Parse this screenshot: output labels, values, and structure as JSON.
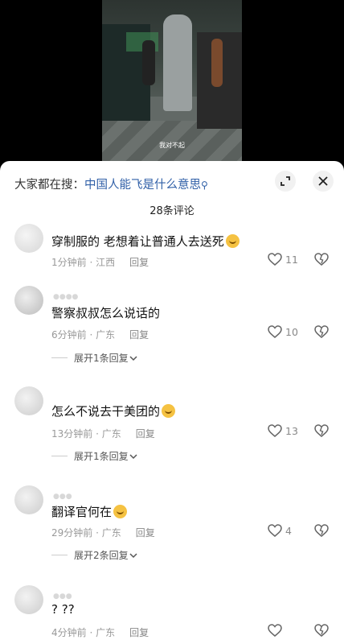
{
  "video": {
    "subtitle": "我对不起"
  },
  "panel": {
    "search_prefix": "大家都在搜：",
    "search_query": "中国人能飞是什么意思",
    "comment_count_title": "28条评论"
  },
  "icons": {
    "expand": "expand-arrows-icon",
    "close": "close-icon",
    "like": "heart-outline-icon",
    "dislike": "broken-heart-icon",
    "reply_chevron": "chevron-down-icon"
  },
  "comments": [
    {
      "text": "穿制服的 老想着让普通人去送死",
      "emoji": "laughing-crying-emoji",
      "time": "1分钟前 · 江西",
      "reply": "回复",
      "likes": "11"
    },
    {
      "text": "警察叔叔怎么说话的",
      "time": "6分钟前 · 广东",
      "reply": "回复",
      "likes": "10",
      "expand": "展开1条回复"
    },
    {
      "text": "怎么不说去干美团的",
      "emoji": "grinning-emoji",
      "time": "13分钟前 · 广东",
      "reply": "回复",
      "likes": "13",
      "expand": "展开1条回复"
    },
    {
      "text": "翻译官何在",
      "emoji": "pleading-emoji",
      "time": "29分钟前 · 广东",
      "reply": "回复",
      "likes": "4",
      "expand": "展开2条回复"
    },
    {
      "text": "? ??",
      "time": "4分钟前 · 广东",
      "reply": "回复",
      "likes": ""
    }
  ]
}
